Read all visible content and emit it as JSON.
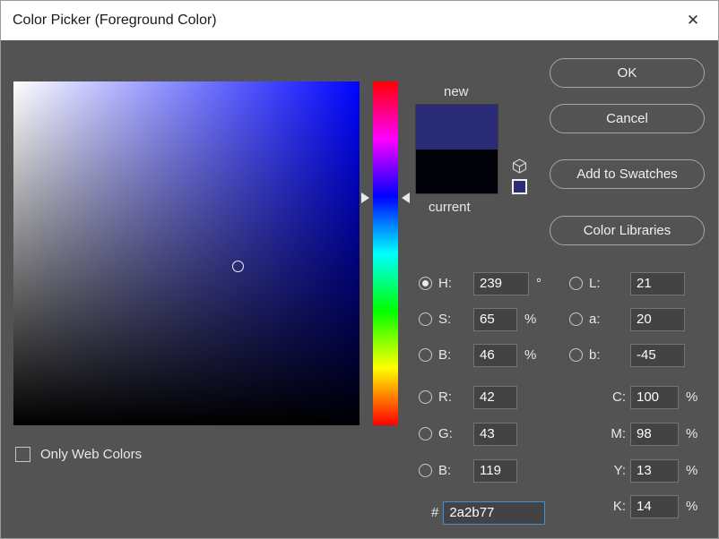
{
  "window": {
    "title": "Color Picker (Foreground Color)",
    "close_glyph": "✕"
  },
  "buttons": [
    {
      "label": "OK"
    },
    {
      "label": "Cancel"
    },
    {
      "label": "Add to Swatches"
    },
    {
      "label": "Color Libraries"
    }
  ],
  "swatches": {
    "new_label": "new",
    "current_label": "current",
    "new_color": "#2a2b77",
    "current_color": "#010109",
    "web_swatch_color": "#2b2c74"
  },
  "fields": {
    "h": {
      "label": "H:",
      "value": "239",
      "unit": "°"
    },
    "s": {
      "label": "S:",
      "value": "65",
      "unit": "%"
    },
    "br": {
      "label": "B:",
      "value": "46",
      "unit": "%"
    },
    "r": {
      "label": "R:",
      "value": "42",
      "unit": ""
    },
    "g": {
      "label": "G:",
      "value": "43",
      "unit": ""
    },
    "b": {
      "label": "B:",
      "value": "119",
      "unit": ""
    },
    "l": {
      "label": "L:",
      "value": "21",
      "unit": ""
    },
    "a": {
      "label": "a:",
      "value": "20",
      "unit": ""
    },
    "lab_b": {
      "label": "b:",
      "value": "-45",
      "unit": ""
    },
    "c": {
      "label": "C:",
      "value": "100",
      "unit": "%"
    },
    "m": {
      "label": "M:",
      "value": "98",
      "unit": "%"
    },
    "y": {
      "label": "Y:",
      "value": "13",
      "unit": "%"
    },
    "k": {
      "label": "K:",
      "value": "14",
      "unit": "%"
    }
  },
  "hex": {
    "prefix": "#",
    "value": "2a2b77"
  },
  "checkbox": {
    "label": "Only Web Colors",
    "checked": false
  },
  "colors": {
    "hue": "#0004ff",
    "dialog_bg": "#535353",
    "titlebar_bg": "#ffffff",
    "hex_focus_border": "#4090d8"
  }
}
